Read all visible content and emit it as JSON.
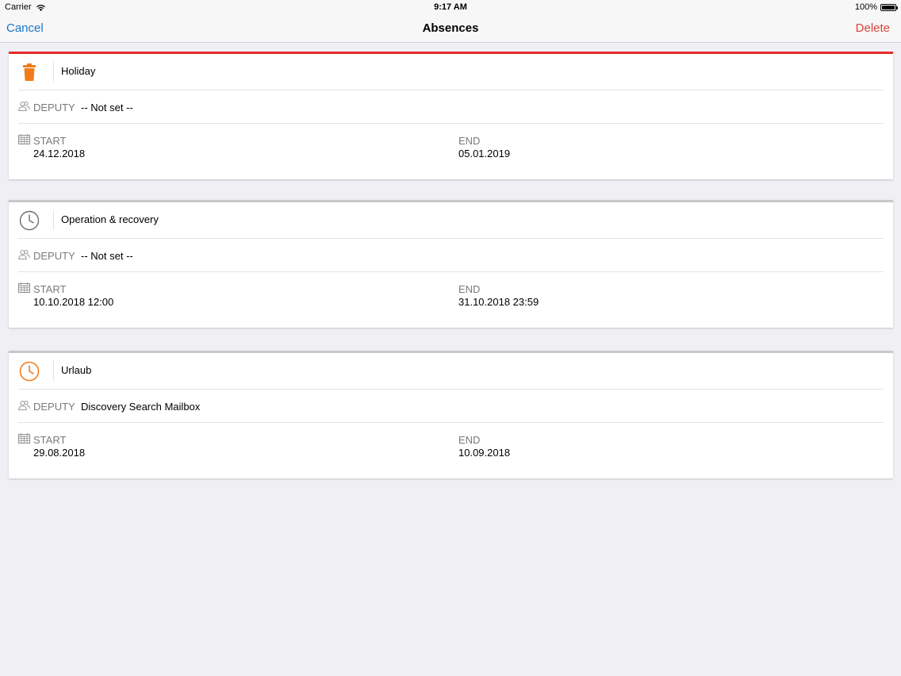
{
  "status_bar": {
    "carrier": "Carrier",
    "time": "9:17 AM",
    "battery": "100%"
  },
  "nav": {
    "cancel_label": "Cancel",
    "title": "Absences",
    "delete_label": "Delete"
  },
  "labels": {
    "deputy": "DEPUTY",
    "start": "START",
    "end": "END"
  },
  "absences": [
    {
      "name": "Holiday",
      "icon": "trash-icon",
      "deputy": "-- Not set --",
      "start": "24.12.2018",
      "end": "05.01.2019",
      "selected": true,
      "accent": "#e52b2b"
    },
    {
      "name": "Operation & recovery",
      "icon": "clock-icon",
      "deputy": "-- Not set --",
      "start": "10.10.2018 12:00",
      "end": "31.10.2018 23:59",
      "selected": false
    },
    {
      "name": "Urlaub",
      "icon": "clock-icon",
      "deputy": "Discovery Search Mailbox",
      "start": "29.08.2018",
      "end": "10.09.2018",
      "selected": false
    }
  ],
  "colors": {
    "link": "#1a74d0",
    "destructive": "#d9463d",
    "orange_icon": "#f07d1a",
    "gray_icon": "#6d6d72"
  }
}
